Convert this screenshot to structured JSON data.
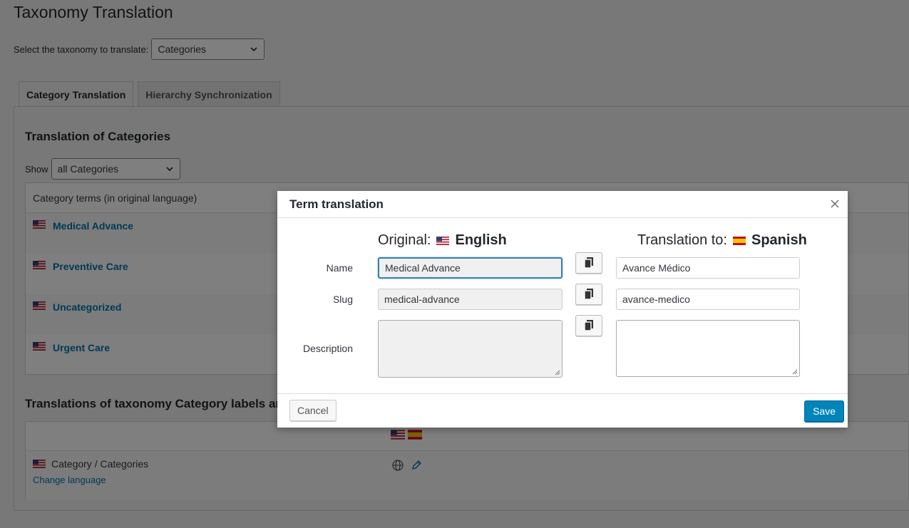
{
  "page": {
    "title": "Taxonomy Translation"
  },
  "taxonomy_select": {
    "label": "Select the taxonomy to translate:",
    "value": "Categories"
  },
  "tabs": [
    {
      "label": "Category Translation",
      "active": true
    },
    {
      "label": "Hierarchy Synchronization",
      "active": false
    }
  ],
  "section1": {
    "title": "Translation of Categories",
    "show_label": "Show",
    "show_value": "all Categories"
  },
  "terms_table": {
    "header": "Category terms (in original language)",
    "rows": [
      "Medical Advance",
      "Preventive Care",
      "Uncategorized",
      "Urgent Care"
    ]
  },
  "section2": {
    "title": "Translations of taxonomy Category labels and"
  },
  "labels_table": {
    "row_label": "Category / Categories",
    "change_language": "Change language"
  },
  "dialog": {
    "title": "Term translation",
    "original_prefix": "Original:",
    "original_lang": "English",
    "translation_prefix": "Translation to:",
    "translation_lang": "Spanish",
    "fields": {
      "name_label": "Name",
      "slug_label": "Slug",
      "description_label": "Description",
      "name_original": "Medical Advance",
      "slug_original": "medical-advance",
      "name_translation": "Avance Médico",
      "slug_translation": "avance-medico"
    },
    "cancel": "Cancel",
    "save": "Save"
  },
  "icons": [
    "chevron-down-icon",
    "us-flag-icon",
    "es-flag-icon",
    "globe-icon",
    "pencil-icon",
    "close-icon",
    "copy-icon",
    "resize-grip-icon"
  ],
  "colors": {
    "link": "#0073aa",
    "primary_button": "#0085ba",
    "focus_border": "#3a7fb0"
  }
}
